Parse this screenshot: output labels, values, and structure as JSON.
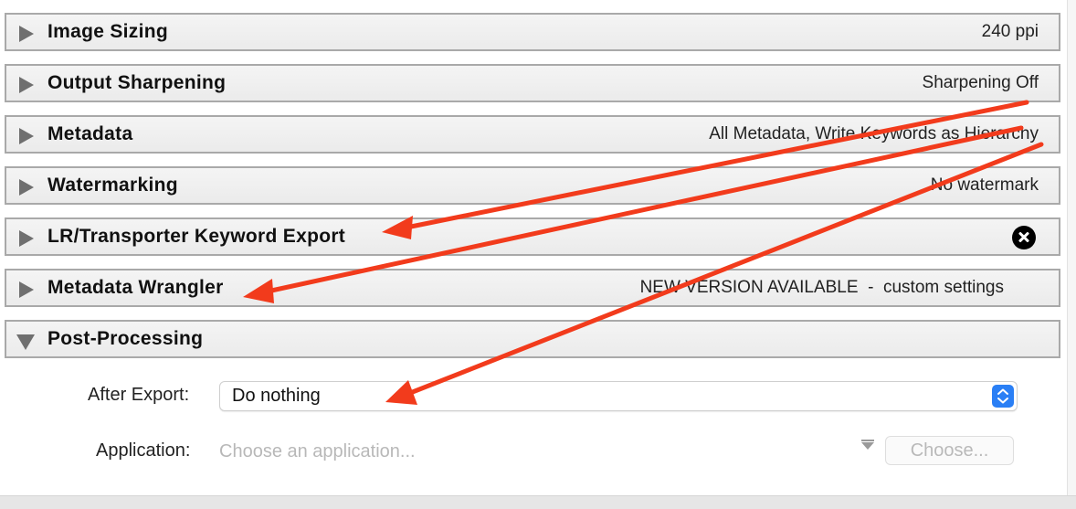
{
  "sections": [
    {
      "title": "Image Sizing",
      "summary": "240 ppi",
      "expanded": false
    },
    {
      "title": "Output Sharpening",
      "summary": "Sharpening Off",
      "expanded": false
    },
    {
      "title": "Metadata",
      "summary": "All Metadata, Write Keywords as Hierarchy",
      "expanded": false
    },
    {
      "title": "Watermarking",
      "summary": "No watermark",
      "expanded": false
    },
    {
      "title": "LR/Transporter Keyword Export",
      "summary": "",
      "expanded": false
    },
    {
      "title": "Metadata Wrangler",
      "summary": "NEW VERSION AVAILABLE  -  custom settings",
      "expanded": false
    },
    {
      "title": "Post-Processing",
      "summary": "",
      "expanded": true
    }
  ],
  "post_processing": {
    "after_export_label": "After Export:",
    "after_export_value": "Do nothing",
    "application_label": "Application:",
    "application_placeholder": "Choose an application...",
    "choose_button": "Choose..."
  },
  "colors": {
    "annotation_arrow": "#f23b1c",
    "stepper_accent": "#2a7ff5"
  }
}
